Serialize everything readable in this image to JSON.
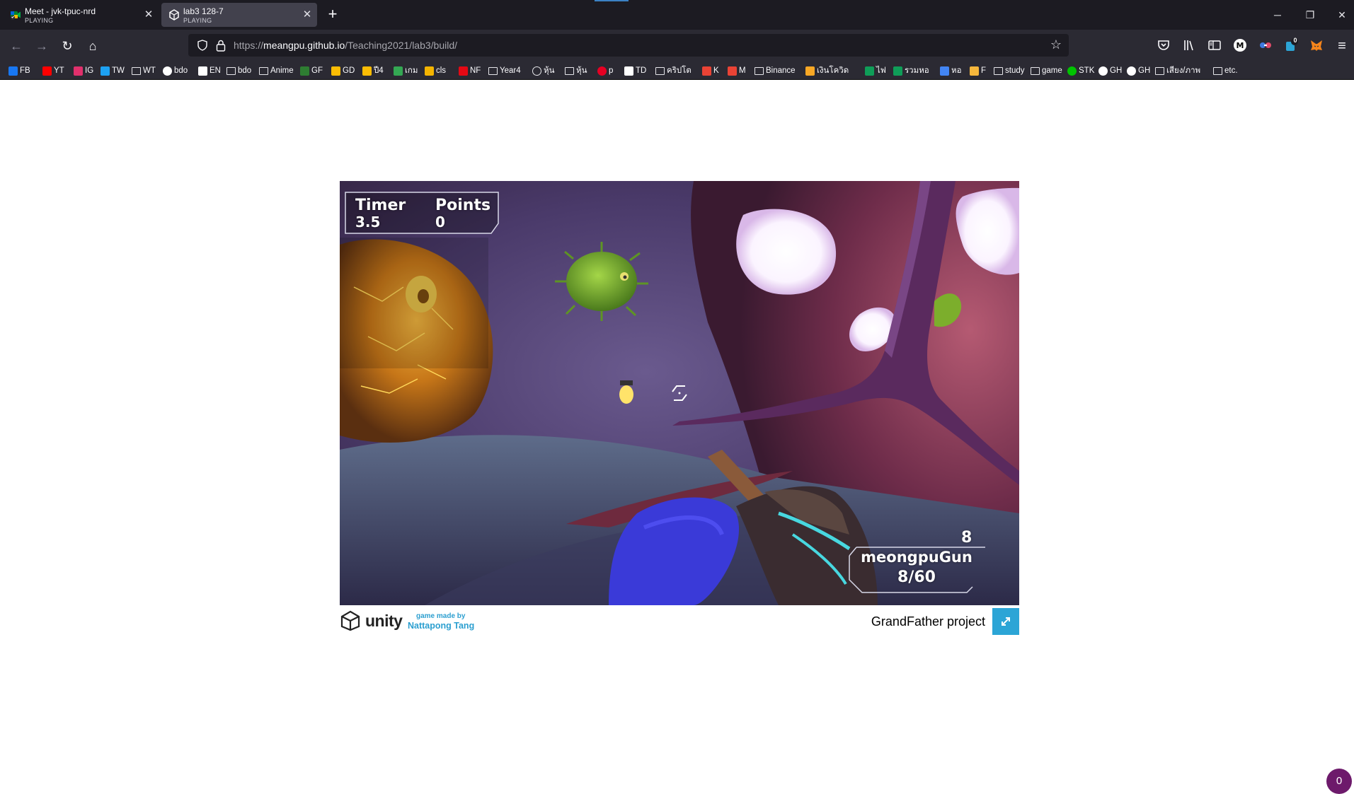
{
  "browser": {
    "tabs": [
      {
        "title": "Meet - jvk-tpuc-nrd",
        "status": "PLAYING",
        "active": false
      },
      {
        "title": "lab3 128-7",
        "status": "PLAYING",
        "active": true
      }
    ],
    "new_tab_label": "+",
    "url": {
      "prefix": "https://",
      "domain": "meangpu.github.io",
      "path": "/Teaching2021/lab3/build/"
    },
    "toolbar_badge": "0",
    "bookmarks": [
      {
        "label": "FB",
        "icon": "facebook-icon",
        "color": "#1877f2"
      },
      {
        "label": "YT",
        "icon": "youtube-icon",
        "color": "#ff0000"
      },
      {
        "label": "IG",
        "icon": "instagram-icon",
        "color": "#e1306c"
      },
      {
        "label": "TW",
        "icon": "twitter-icon",
        "color": "#1da1f2"
      },
      {
        "label": "WT",
        "icon": "folder-icon",
        "color": ""
      },
      {
        "label": "bdo",
        "icon": "google-icon",
        "color": "#ffffff"
      },
      {
        "label": "EN",
        "icon": "bold-b-icon",
        "color": "#ffffff"
      },
      {
        "label": "bdo",
        "icon": "folder-icon",
        "color": ""
      },
      {
        "label": "Anime",
        "icon": "folder-icon",
        "color": ""
      },
      {
        "label": "GF",
        "icon": "green-bars-icon",
        "color": "#2e7d32"
      },
      {
        "label": "GD",
        "icon": "google-drive-icon",
        "color": "#fbbc04"
      },
      {
        "label": "ปี4",
        "icon": "google-drive-icon",
        "color": "#fbbc04"
      },
      {
        "label": "เกม",
        "icon": "google-drive-icon",
        "color": "#34a853"
      },
      {
        "label": "cls",
        "icon": "classroom-icon",
        "color": "#f4b400"
      },
      {
        "label": "NF",
        "icon": "netflix-icon",
        "color": "#e50914"
      },
      {
        "label": "Year4",
        "icon": "folder-icon",
        "color": ""
      },
      {
        "label": "หุ้น",
        "icon": "globe-icon",
        "color": ""
      },
      {
        "label": "หุ้น",
        "icon": "folder-icon",
        "color": ""
      },
      {
        "label": "p",
        "icon": "pinterest-icon",
        "color": "#e60023"
      },
      {
        "label": "TD",
        "icon": "tradingview-icon",
        "color": "#ffffff"
      },
      {
        "label": "คริปโต",
        "icon": "folder-icon",
        "color": ""
      },
      {
        "label": "K",
        "icon": "gmail-icon",
        "color": "#ea4335"
      },
      {
        "label": "M",
        "icon": "gmail-icon",
        "color": "#ea4335"
      },
      {
        "label": "Binance",
        "icon": "folder-icon",
        "color": ""
      },
      {
        "label": "เงินโควิด",
        "icon": "flame-icon",
        "color": "#f9a825"
      },
      {
        "label": "ไฟ",
        "icon": "green-plus-icon",
        "color": "#0f9d58"
      },
      {
        "label": "รวมหอ",
        "icon": "green-plus-icon",
        "color": "#0f9d58"
      },
      {
        "label": "หอ",
        "icon": "google-drive-icon",
        "color": "#4285f4"
      },
      {
        "label": "F",
        "icon": "hand-icon",
        "color": "#f6b73c"
      },
      {
        "label": "study",
        "icon": "folder-icon",
        "color": ""
      },
      {
        "label": "game",
        "icon": "folder-icon",
        "color": ""
      },
      {
        "label": "STK",
        "icon": "line-icon",
        "color": "#00c300"
      },
      {
        "label": "GH",
        "icon": "skull-icon",
        "color": "#ffffff"
      },
      {
        "label": "GH",
        "icon": "github-icon",
        "color": "#ffffff"
      },
      {
        "label": "เสียง/ภาพ",
        "icon": "folder-icon",
        "color": ""
      },
      {
        "label": "etc.",
        "icon": "folder-icon",
        "color": ""
      }
    ]
  },
  "game": {
    "hud": {
      "timer_label": "Timer",
      "timer_value": "3.5",
      "points_label": "Points",
      "points_value": "0",
      "gun_name": "meongpuGun",
      "ammo": "8/60",
      "gun_display_count": "8"
    }
  },
  "footer": {
    "logo_text": "unity",
    "made_by_line1": "game made by",
    "made_by_line2": "Nattapong Tang",
    "project_title": "GrandFather project"
  },
  "notification_count": "0",
  "colors": {
    "tab_strip": "#1c1b22",
    "toolbar": "#2b2a33",
    "accent_blue": "#2ca5d6",
    "badge_purple": "#6d1a6b"
  }
}
